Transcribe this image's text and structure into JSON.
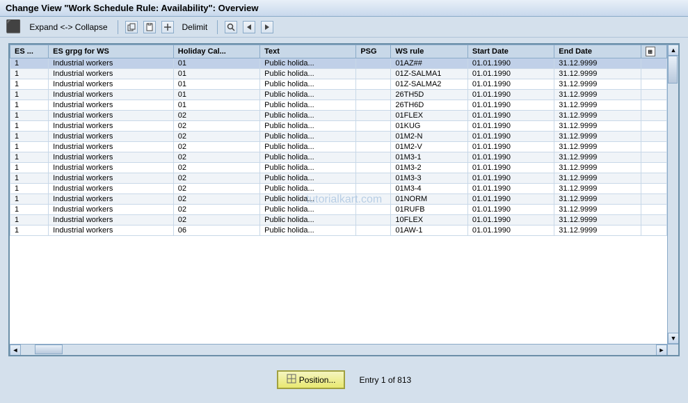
{
  "title": "Change View \"Work Schedule Rule: Availability\": Overview",
  "toolbar": {
    "expand_collapse_label": "Expand <-> Collapse",
    "delimit_label": "Delimit",
    "icons": [
      "copy-icon",
      "paste-icon",
      "delimit-icon",
      "search-icon",
      "prev-icon",
      "next-icon"
    ]
  },
  "table": {
    "columns": [
      "ES ...",
      "ES grpg for WS",
      "Holiday Cal...",
      "Text",
      "PSG",
      "WS rule",
      "Start Date",
      "End Date",
      ""
    ],
    "rows": [
      {
        "es": "1",
        "esgrp": "Industrial workers",
        "holcal": "01",
        "text": "Public holida...",
        "psg": "",
        "wsrule": "01AZ##",
        "startdate": "01.01.1990",
        "enddate": "31.12.9999"
      },
      {
        "es": "1",
        "esgrp": "Industrial workers",
        "holcal": "01",
        "text": "Public holida...",
        "psg": "",
        "wsrule": "01Z-SALMA1",
        "startdate": "01.01.1990",
        "enddate": "31.12.9999"
      },
      {
        "es": "1",
        "esgrp": "Industrial workers",
        "holcal": "01",
        "text": "Public holida...",
        "psg": "",
        "wsrule": "01Z-SALMA2",
        "startdate": "01.01.1990",
        "enddate": "31.12.9999"
      },
      {
        "es": "1",
        "esgrp": "Industrial workers",
        "holcal": "01",
        "text": "Public holida...",
        "psg": "",
        "wsrule": "26TH5D",
        "startdate": "01.01.1990",
        "enddate": "31.12.9999"
      },
      {
        "es": "1",
        "esgrp": "Industrial workers",
        "holcal": "01",
        "text": "Public holida...",
        "psg": "",
        "wsrule": "26TH6D",
        "startdate": "01.01.1990",
        "enddate": "31.12.9999"
      },
      {
        "es": "1",
        "esgrp": "Industrial workers",
        "holcal": "02",
        "text": "Public holida...",
        "psg": "",
        "wsrule": "01FLEX",
        "startdate": "01.01.1990",
        "enddate": "31.12.9999"
      },
      {
        "es": "1",
        "esgrp": "Industrial workers",
        "holcal": "02",
        "text": "Public holida...",
        "psg": "",
        "wsrule": "01KUG",
        "startdate": "01.01.1990",
        "enddate": "31.12.9999"
      },
      {
        "es": "1",
        "esgrp": "Industrial workers",
        "holcal": "02",
        "text": "Public holida...",
        "psg": "",
        "wsrule": "01M2-N",
        "startdate": "01.01.1990",
        "enddate": "31.12.9999"
      },
      {
        "es": "1",
        "esgrp": "Industrial workers",
        "holcal": "02",
        "text": "Public holida...",
        "psg": "",
        "wsrule": "01M2-V",
        "startdate": "01.01.1990",
        "enddate": "31.12.9999"
      },
      {
        "es": "1",
        "esgrp": "Industrial workers",
        "holcal": "02",
        "text": "Public holida...",
        "psg": "",
        "wsrule": "01M3-1",
        "startdate": "01.01.1990",
        "enddate": "31.12.9999"
      },
      {
        "es": "1",
        "esgrp": "Industrial workers",
        "holcal": "02",
        "text": "Public holida...",
        "psg": "",
        "wsrule": "01M3-2",
        "startdate": "01.01.1990",
        "enddate": "31.12.9999"
      },
      {
        "es": "1",
        "esgrp": "Industrial workers",
        "holcal": "02",
        "text": "Public holida...",
        "psg": "",
        "wsrule": "01M3-3",
        "startdate": "01.01.1990",
        "enddate": "31.12.9999"
      },
      {
        "es": "1",
        "esgrp": "Industrial workers",
        "holcal": "02",
        "text": "Public holida...",
        "psg": "",
        "wsrule": "01M3-4",
        "startdate": "01.01.1990",
        "enddate": "31.12.9999"
      },
      {
        "es": "1",
        "esgrp": "Industrial workers",
        "holcal": "02",
        "text": "Public holida...",
        "psg": "",
        "wsrule": "01NORM",
        "startdate": "01.01.1990",
        "enddate": "31.12.9999"
      },
      {
        "es": "1",
        "esgrp": "Industrial workers",
        "holcal": "02",
        "text": "Public holida...",
        "psg": "",
        "wsrule": "01RUFB",
        "startdate": "01.01.1990",
        "enddate": "31.12.9999"
      },
      {
        "es": "1",
        "esgrp": "Industrial workers",
        "holcal": "02",
        "text": "Public holida...",
        "psg": "",
        "wsrule": "10FLEX",
        "startdate": "01.01.1990",
        "enddate": "31.12.9999"
      },
      {
        "es": "1",
        "esgrp": "Industrial workers",
        "holcal": "06",
        "text": "Public holida...",
        "psg": "",
        "wsrule": "01AW-1",
        "startdate": "01.01.1990",
        "enddate": "31.12.9999"
      }
    ]
  },
  "bottom": {
    "position_btn_label": "Position...",
    "entry_info": "Entry 1 of 813"
  },
  "watermark": "tutorialkart.com"
}
